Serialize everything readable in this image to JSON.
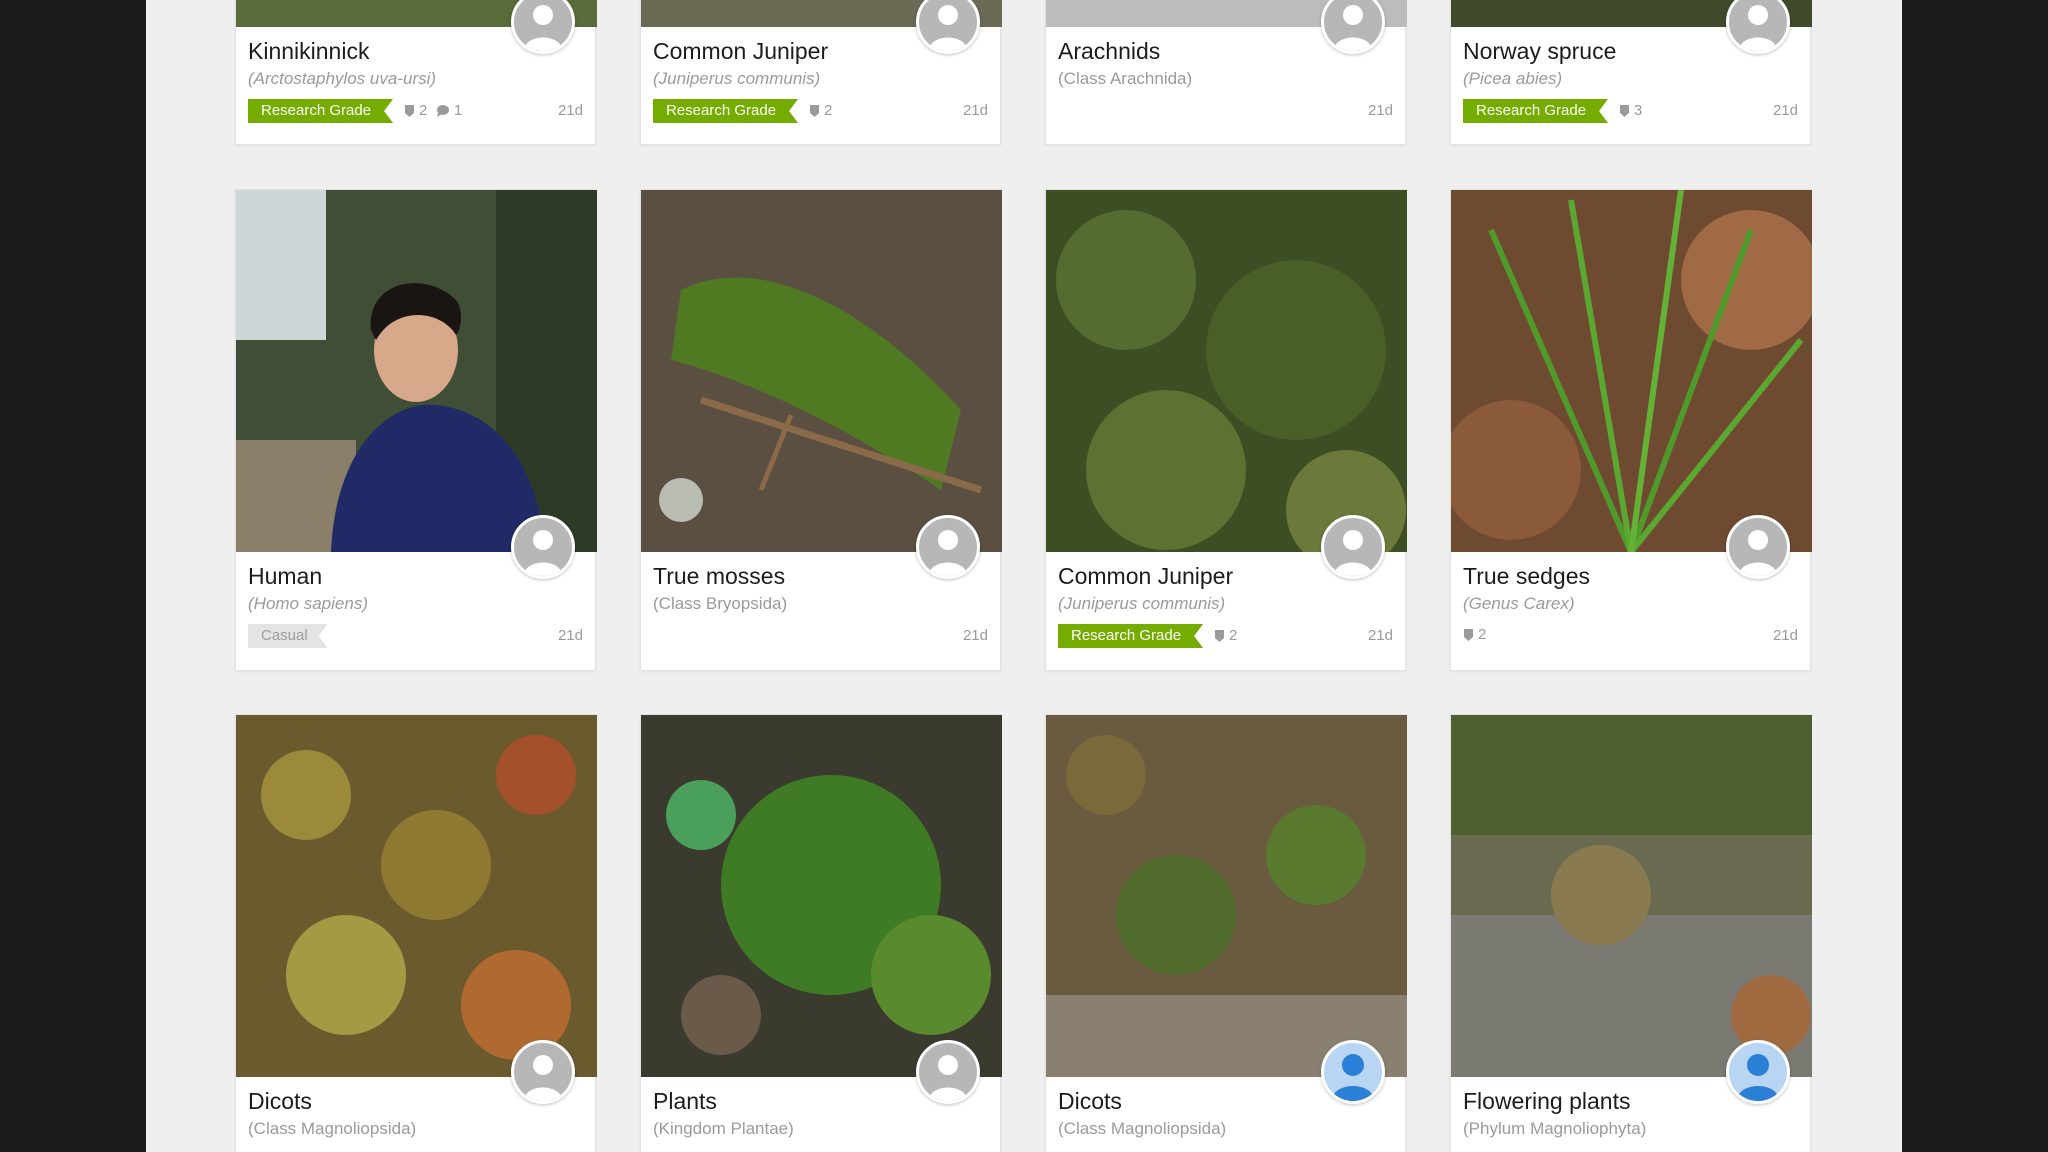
{
  "cards": [
    {
      "name": "Kinnikinnick",
      "scientific": "(Arctostaphylos uva-ursi)",
      "quality": "Research Grade",
      "ids": "2",
      "comments": "1",
      "age": "21d",
      "avatar": "default-user-icon"
    },
    {
      "name": "Common Juniper",
      "scientific": "(Juniperus communis)",
      "quality": "Research Grade",
      "ids": "2",
      "age": "21d",
      "avatar": "default-user-icon"
    },
    {
      "name": "Arachnids",
      "scientific": "(Class Arachnida)",
      "age": "21d",
      "avatar": "default-user-icon"
    },
    {
      "name": "Norway spruce",
      "scientific": "(Picea abies)",
      "quality": "Research Grade",
      "ids": "3",
      "age": "21d",
      "avatar": "default-user-icon"
    },
    {
      "name": "Human",
      "scientific": "(Homo sapiens)",
      "quality": "Casual",
      "age": "21d",
      "avatar": "default-user-icon"
    },
    {
      "name": "True mosses",
      "scientific": "(Class Bryopsida)",
      "age": "21d",
      "avatar": "default-user-icon"
    },
    {
      "name": "Common Juniper",
      "scientific": "(Juniperus communis)",
      "quality": "Research Grade",
      "ids": "2",
      "age": "21d",
      "avatar": "default-user-icon"
    },
    {
      "name": "True sedges",
      "scientific": "(Genus Carex)",
      "ids": "2",
      "age": "21d",
      "avatar": "default-user-icon"
    },
    {
      "name": "Dicots",
      "scientific": "(Class Magnoliopsida)",
      "avatar": "default-user-icon"
    },
    {
      "name": "Plants",
      "scientific": "(Kingdom Plantae)",
      "avatar": "default-user-icon"
    },
    {
      "name": "Dicots",
      "scientific": "(Class Magnoliopsida)",
      "avatar": "blue-user-icon"
    },
    {
      "name": "Flowering plants",
      "scientific": "(Phylum Magnoliophyta)",
      "avatar": "blue-user-icon"
    }
  ],
  "colors": {
    "research_grade": "#74ac00",
    "casual": "#e4e4e4",
    "page_bg": "#efefef",
    "outer_bg": "#1b1b1b"
  }
}
